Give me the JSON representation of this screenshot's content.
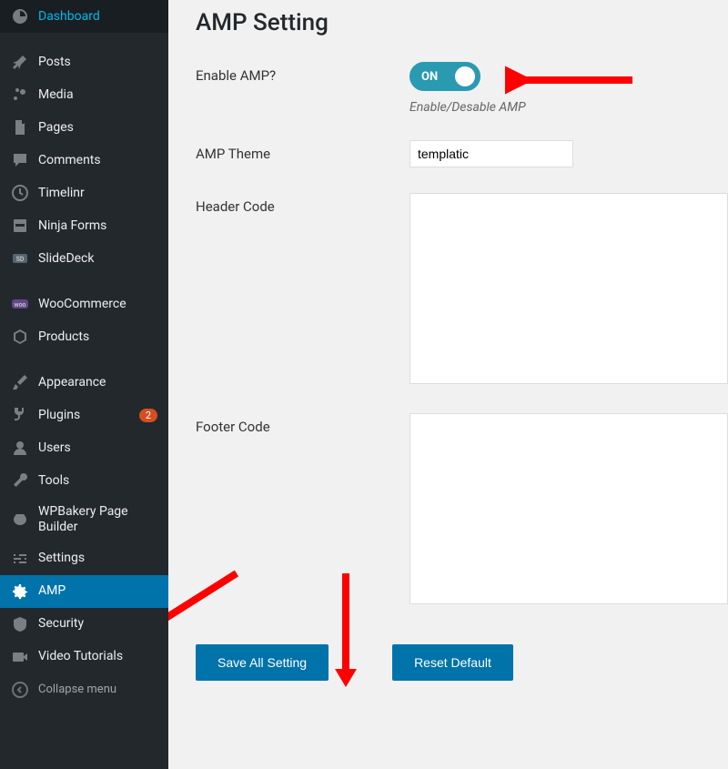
{
  "sidebar": {
    "items": [
      {
        "label": "Dashboard",
        "icon": "dashboard"
      },
      {
        "label": "Posts",
        "icon": "pin"
      },
      {
        "label": "Media",
        "icon": "media"
      },
      {
        "label": "Pages",
        "icon": "page"
      },
      {
        "label": "Comments",
        "icon": "comment"
      },
      {
        "label": "Timelinr",
        "icon": "clock"
      },
      {
        "label": "Ninja Forms",
        "icon": "ninja"
      },
      {
        "label": "SlideDeck",
        "icon": "sd"
      },
      {
        "label": "WooCommerce",
        "icon": "woo"
      },
      {
        "label": "Products",
        "icon": "cube"
      },
      {
        "label": "Appearance",
        "icon": "brush"
      },
      {
        "label": "Plugins",
        "icon": "plug",
        "badge": "2"
      },
      {
        "label": "Users",
        "icon": "user"
      },
      {
        "label": "Tools",
        "icon": "wrench"
      },
      {
        "label": "WPBakery Page Builder",
        "icon": "wpb"
      },
      {
        "label": "Settings",
        "icon": "sliders"
      },
      {
        "label": "AMP",
        "icon": "gear",
        "active": true
      },
      {
        "label": "Security",
        "icon": "shield"
      },
      {
        "label": "Video Tutorials",
        "icon": "video"
      }
    ],
    "collapse_label": "Collapse menu"
  },
  "page": {
    "title": "AMP Setting",
    "enable_label": "Enable AMP?",
    "enable_value": "ON",
    "enable_desc": "Enable/Desable AMP",
    "theme_label": "AMP Theme",
    "theme_value": "templatic",
    "header_code_label": "Header Code",
    "header_code_value": "",
    "footer_code_label": "Footer Code",
    "footer_code_value": "",
    "save_label": "Save All Setting",
    "reset_label": "Reset Default"
  },
  "annotations": {
    "arrow_color": "#ff0000"
  }
}
